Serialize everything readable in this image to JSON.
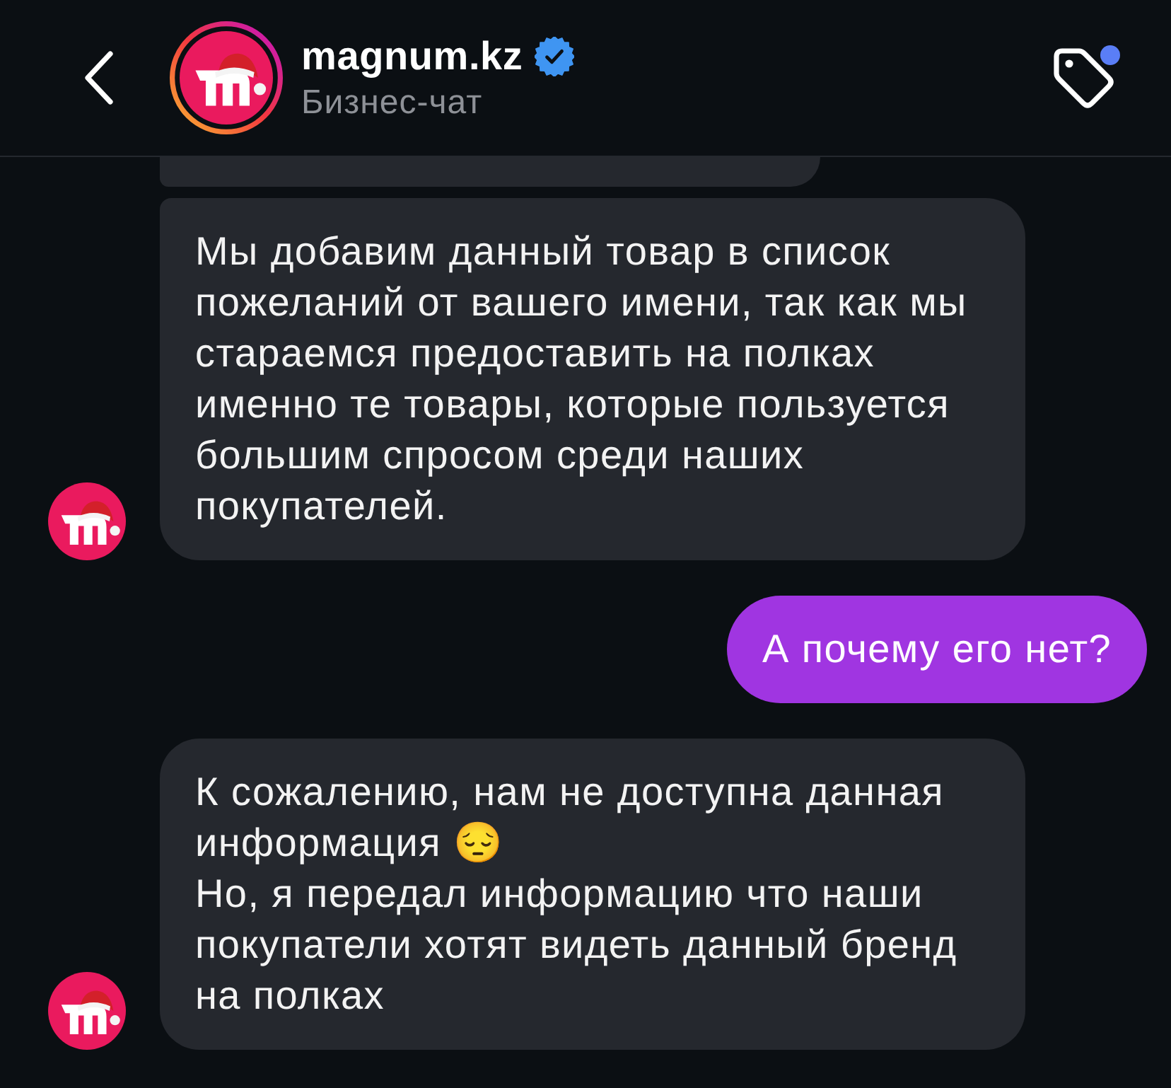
{
  "header": {
    "title": "magnum.kz",
    "verified": true,
    "subtitle": "Бизнес-чат",
    "tag_dot": true
  },
  "messages": [
    {
      "kind": "incoming",
      "cut_off": true,
      "avatar": false
    },
    {
      "kind": "incoming",
      "cut_off": false,
      "avatar": true,
      "paragraphs": [
        "Мы добавим данный товар в список пожеланий от вашего имени, так как мы стараемся предоставить на полках именно те товары, которые пользуется большим спросом среди наших покупателей."
      ]
    },
    {
      "kind": "outgoing",
      "paragraphs": [
        "А почему его нет?"
      ]
    },
    {
      "kind": "incoming",
      "cut_off": false,
      "avatar": true,
      "paragraphs": [
        "К сожалению, нам не доступна данная информация 😔",
        "Но, я передал информацию что наши покупатели хотят видеть данный бренд на полках"
      ]
    }
  ]
}
